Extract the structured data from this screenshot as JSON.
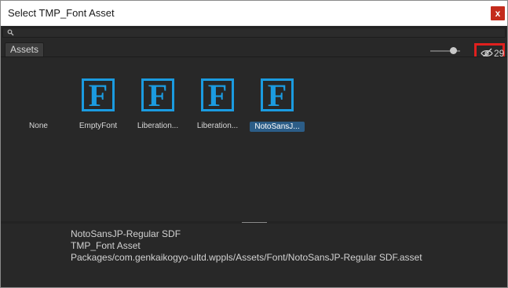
{
  "window": {
    "title": "Select TMP_Font Asset",
    "close_glyph": "x"
  },
  "search": {
    "value": "",
    "icon": "search-icon"
  },
  "toolbar": {
    "tab_label": "Assets",
    "hidden_count": "29",
    "icon": "eye-slash-icon",
    "zoom_slider_level": 0.75
  },
  "assets": [
    {
      "label": "None",
      "has_thumbnail": false,
      "selected": false
    },
    {
      "label": "EmptyFont",
      "has_thumbnail": true,
      "glyph": "F",
      "selected": false
    },
    {
      "label": "Liberation...",
      "has_thumbnail": true,
      "glyph": "F",
      "selected": false
    },
    {
      "label": "Liberation...",
      "has_thumbnail": true,
      "glyph": "F",
      "selected": false
    },
    {
      "label": "NotoSansJ...",
      "has_thumbnail": true,
      "glyph": "F",
      "selected": true
    }
  ],
  "details": {
    "name": "NotoSansJP-Regular SDF",
    "type": "TMP_Font Asset",
    "path": "Packages/com.genkaikogyo-ultd.wppls/Assets/Font/NotoSansJP-Regular SDF.asset"
  },
  "colors": {
    "accent_icon": "#1b9be0",
    "selection": "#2c5d87",
    "highlight_box": "#e0201e",
    "close_button": "#c42b1c"
  }
}
